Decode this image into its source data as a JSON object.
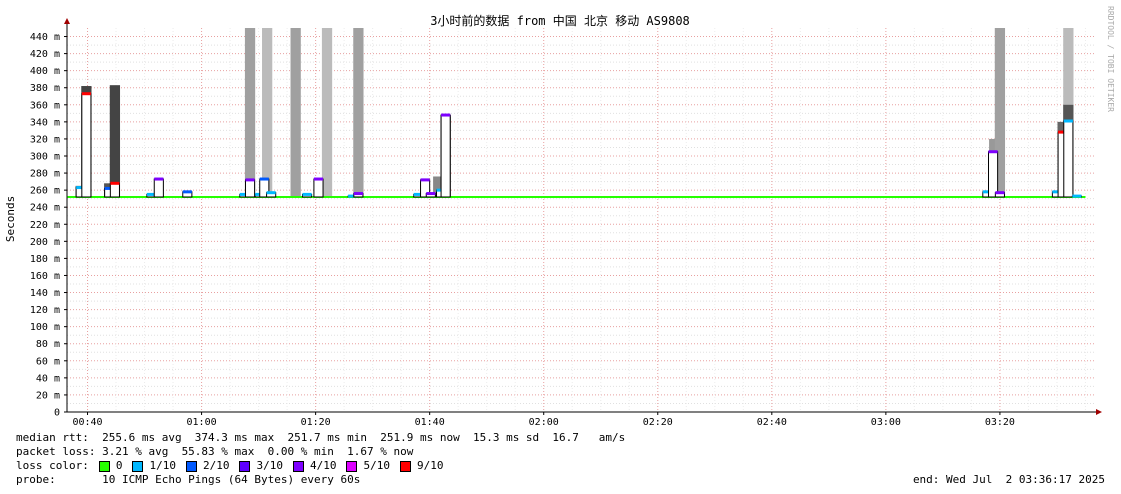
{
  "chart_data": {
    "type": "line",
    "title": "3小时前的数据 from 中国 北京 移动 AS9808",
    "ylabel": "Seconds",
    "watermark": "RRDTOOL / TOBI OETIKER",
    "ylim": [
      0,
      450
    ],
    "y_ticks": [
      {
        "value": 0,
        "label": "0"
      },
      {
        "value": 20,
        "label": "20 m"
      },
      {
        "value": 40,
        "label": "40 m"
      },
      {
        "value": 60,
        "label": "60 m"
      },
      {
        "value": 80,
        "label": "80 m"
      },
      {
        "value": 100,
        "label": "100 m"
      },
      {
        "value": 120,
        "label": "120 m"
      },
      {
        "value": 140,
        "label": "140 m"
      },
      {
        "value": 160,
        "label": "160 m"
      },
      {
        "value": 180,
        "label": "180 m"
      },
      {
        "value": 200,
        "label": "200 m"
      },
      {
        "value": 220,
        "label": "220 m"
      },
      {
        "value": 240,
        "label": "240 m"
      },
      {
        "value": 260,
        "label": "260 m"
      },
      {
        "value": 280,
        "label": "280 m"
      },
      {
        "value": 300,
        "label": "300 m"
      },
      {
        "value": 320,
        "label": "320 m"
      },
      {
        "value": 340,
        "label": "340 m"
      },
      {
        "value": 360,
        "label": "360 m"
      },
      {
        "value": 380,
        "label": "380 m"
      },
      {
        "value": 400,
        "label": "400 m"
      },
      {
        "value": 420,
        "label": "420 m"
      },
      {
        "value": 440,
        "label": "440 m"
      }
    ],
    "x_range_min": [
      36.4,
      216.5
    ],
    "x_ticks": [
      {
        "t": 40,
        "label": "00:40"
      },
      {
        "t": 60,
        "label": "01:00"
      },
      {
        "t": 80,
        "label": "01:20"
      },
      {
        "t": 100,
        "label": "01:40"
      },
      {
        "t": 120,
        "label": "02:00"
      },
      {
        "t": 140,
        "label": "02:20"
      },
      {
        "t": 160,
        "label": "02:40"
      },
      {
        "t": 180,
        "label": "03:00"
      },
      {
        "t": 200,
        "label": "03:20"
      }
    ],
    "baseline_ms": 252,
    "baseline_range_min": [
      36.5,
      215.0
    ],
    "smoke_columns": [
      {
        "t": 38.8,
        "min": 252,
        "max": 265,
        "shade": "#555555"
      },
      {
        "t": 39.8,
        "min": 252,
        "max": 382,
        "shade": "#444444"
      },
      {
        "t": 43.8,
        "min": 252,
        "max": 268,
        "shade": "#555555"
      },
      {
        "t": 44.8,
        "min": 252,
        "max": 383,
        "shade": "#444444"
      },
      {
        "t": 68.5,
        "min": 252,
        "max": 450,
        "shade": "#a0a0a0"
      },
      {
        "t": 71.5,
        "min": 252,
        "max": 450,
        "shade": "#bbbbbb"
      },
      {
        "t": 76.5,
        "min": 252,
        "max": 450,
        "shade": "#a0a0a0"
      },
      {
        "t": 82.0,
        "min": 252,
        "max": 450,
        "shade": "#bbbbbb"
      },
      {
        "t": 87.5,
        "min": 252,
        "max": 450,
        "shade": "#a0a0a0"
      },
      {
        "t": 101.5,
        "min": 252,
        "max": 276,
        "shade": "#888888"
      },
      {
        "t": 102.8,
        "min": 252,
        "max": 348,
        "shade": "#333333"
      },
      {
        "t": 199.0,
        "min": 252,
        "max": 320,
        "shade": "#999999"
      },
      {
        "t": 200.0,
        "min": 252,
        "max": 450,
        "shade": "#a0a0a0"
      },
      {
        "t": 211.0,
        "min": 252,
        "max": 340,
        "shade": "#666666"
      },
      {
        "t": 212.0,
        "min": 252,
        "max": 450,
        "shade": "#bbbbbb"
      },
      {
        "t": 212.0,
        "min": 252,
        "max": 360,
        "shade": "#555555"
      }
    ],
    "median_points": [
      {
        "t": 38.8,
        "v": 263,
        "loss": 1
      },
      {
        "t": 39.8,
        "v": 373,
        "loss": 9
      },
      {
        "t": 43.8,
        "v": 262,
        "loss": 2
      },
      {
        "t": 44.8,
        "v": 268,
        "loss": 9
      },
      {
        "t": 51.2,
        "v": 255,
        "loss": 1
      },
      {
        "t": 52.5,
        "v": 273,
        "loss": 4
      },
      {
        "t": 57.5,
        "v": 258,
        "loss": 2
      },
      {
        "t": 67.5,
        "v": 255,
        "loss": 1
      },
      {
        "t": 68.5,
        "v": 272,
        "loss": 4
      },
      {
        "t": 70.2,
        "v": 255,
        "loss": 1
      },
      {
        "t": 71.0,
        "v": 273,
        "loss": 2
      },
      {
        "t": 72.2,
        "v": 257,
        "loss": 1
      },
      {
        "t": 78.5,
        "v": 255,
        "loss": 1
      },
      {
        "t": 80.5,
        "v": 273,
        "loss": 4
      },
      {
        "t": 86.5,
        "v": 253,
        "loss": 1
      },
      {
        "t": 87.5,
        "v": 256,
        "loss": 4
      },
      {
        "t": 98.0,
        "v": 255,
        "loss": 1
      },
      {
        "t": 99.2,
        "v": 272,
        "loss": 4
      },
      {
        "t": 100.2,
        "v": 256,
        "loss": 4
      },
      {
        "t": 102.0,
        "v": 260,
        "loss": 1
      },
      {
        "t": 102.8,
        "v": 348,
        "loss": 4
      },
      {
        "t": 197.8,
        "v": 258,
        "loss": 1
      },
      {
        "t": 198.8,
        "v": 305,
        "loss": 4
      },
      {
        "t": 200.0,
        "v": 257,
        "loss": 4
      },
      {
        "t": 210.0,
        "v": 258,
        "loss": 1
      },
      {
        "t": 211.0,
        "v": 328,
        "loss": 9
      },
      {
        "t": 212.0,
        "v": 341,
        "loss": 1
      },
      {
        "t": 213.5,
        "v": 253,
        "loss": 1
      }
    ],
    "loss_legend": [
      {
        "label": "0",
        "color": "#26ff00"
      },
      {
        "label": "1/10",
        "color": "#00b8ff"
      },
      {
        "label": "2/10",
        "color": "#0059ff"
      },
      {
        "label": "3/10",
        "color": "#5e00ff"
      },
      {
        "label": "4/10",
        "color": "#7e00ff"
      },
      {
        "label": "5/10",
        "color": "#dd00ff"
      },
      {
        "label": "9/10",
        "color": "#ff0000"
      }
    ],
    "loss_color_map": {
      "0": "#26ff00",
      "1": "#00b8ff",
      "2": "#0059ff",
      "3": "#5e00ff",
      "4": "#7e00ff",
      "5": "#dd00ff",
      "9": "#ff0000"
    },
    "grid": true
  },
  "stats": {
    "rtt_line": "median rtt:  255.6 ms avg  374.3 ms max  251.7 ms min  251.9 ms now  15.3 ms sd  16.7   am/s",
    "loss_line": "packet loss: 3.21 % avg  55.83 % max  0.00 % min  1.67 % now",
    "loss_color_label": "loss color:",
    "probe_line": "probe:       10 ICMP Echo Pings (64 Bytes) every 60s",
    "end_line": "end: Wed Jul  2 03:36:17 2025"
  }
}
